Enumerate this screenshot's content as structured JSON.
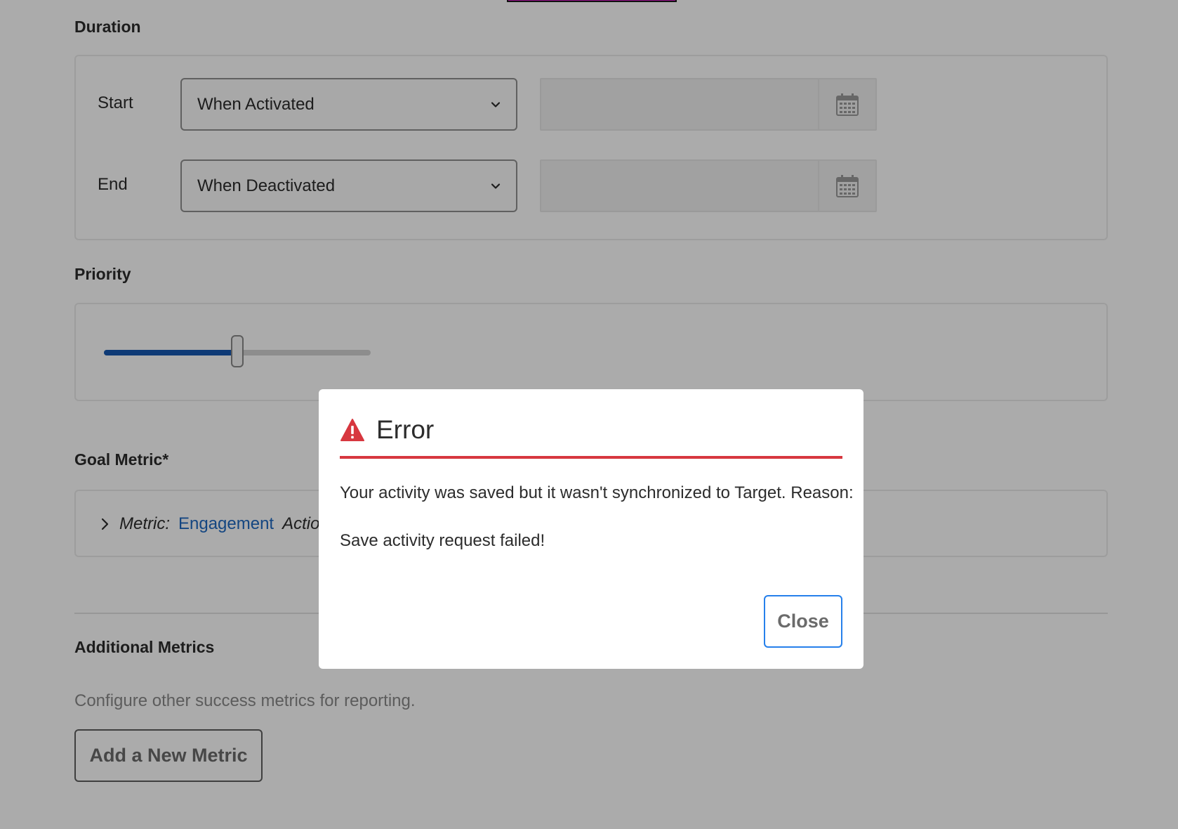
{
  "duration": {
    "title": "Duration",
    "start": {
      "label": "Start",
      "selected": "When Activated",
      "date_value": ""
    },
    "end": {
      "label": "End",
      "selected": "When Deactivated",
      "date_value": ""
    }
  },
  "priority": {
    "title": "Priority",
    "slider_value_fraction": 0.5
  },
  "goal_metric": {
    "title": "Goal Metric*",
    "metric_label": "Metric:",
    "metric_value": "Engagement",
    "action_label": "Action"
  },
  "additional_metrics": {
    "title": "Additional Metrics",
    "description": "Configure other success metrics for reporting.",
    "add_button": "Add a New Metric"
  },
  "dialog": {
    "title": "Error",
    "message": "Your activity was saved but it wasn't synchronized to Target. Reason:",
    "detail": "Save activity request failed!",
    "close_button": "Close"
  },
  "icons": {
    "warning": "alert-triangle-icon",
    "calendar": "calendar-icon",
    "chevron_down": "chevron-down-icon",
    "chevron_right": "chevron-right-icon"
  },
  "colors": {
    "accent_blue": "#1557b0",
    "link_blue": "#1f69c1",
    "error_red": "#d7373f",
    "focus_blue": "#2680eb"
  }
}
